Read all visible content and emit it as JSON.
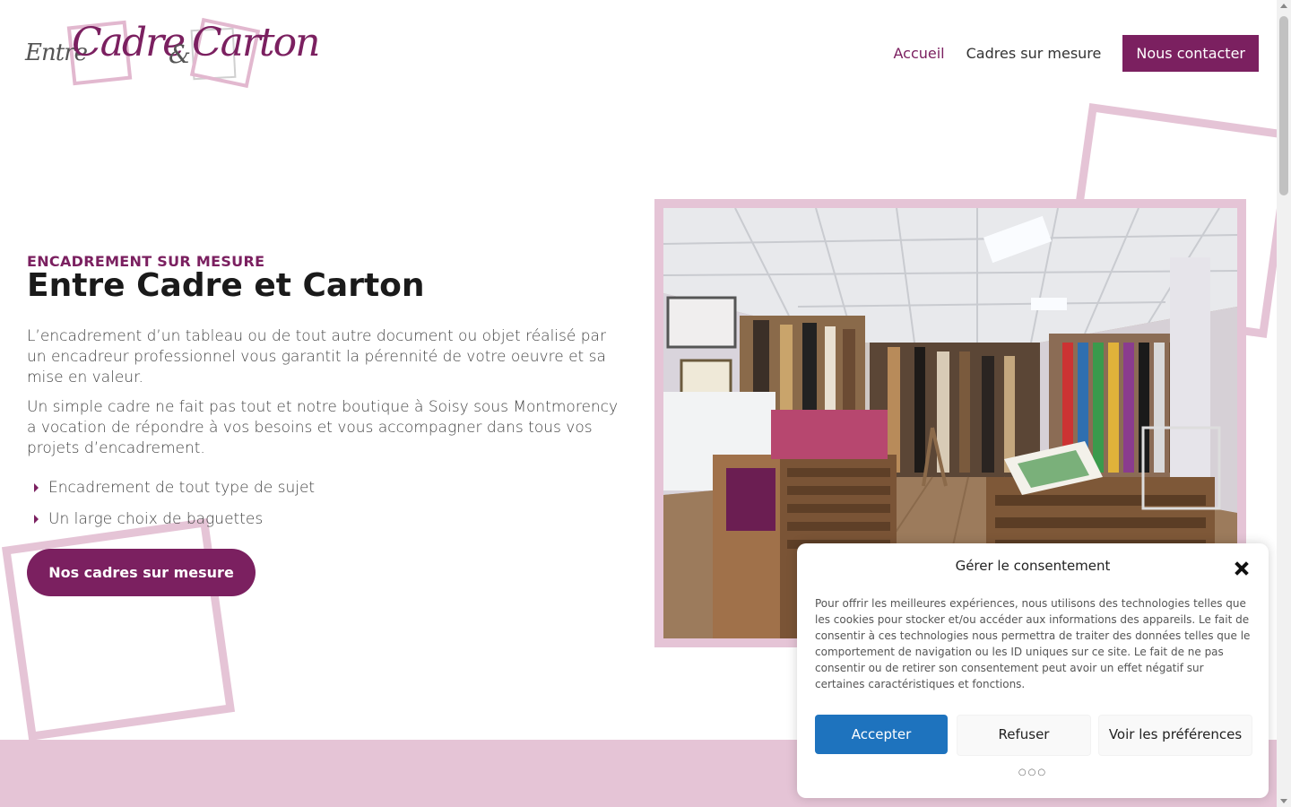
{
  "header": {
    "logo": {
      "word1": "Entre",
      "word2": "Cadre",
      "word3": "&",
      "word4": "Carton"
    },
    "nav": [
      {
        "label": "Accueil"
      },
      {
        "label": "Cadres sur mesure"
      },
      {
        "label": "Nous contacter"
      }
    ]
  },
  "hero": {
    "kicker": "ENCADREMENT SUR MESURE",
    "title": "Entre Cadre et Carton",
    "paragraph1": "L’encadrement d’un tableau ou de tout autre document ou objet réalisé par un encadreur professionnel vous garantit la pérennité de votre oeuvre et sa mise en valeur.",
    "paragraph2": "Un simple cadre ne fait pas tout et notre boutique à Soisy sous Montmorency a vocation de répondre à vos besoins et vous accompagner dans tous vos projets d’encadrement.",
    "bullets": [
      "Encadrement de tout type de sujet",
      "Un large choix de baguettes"
    ],
    "button": "Nos cadres sur mesure"
  },
  "consent": {
    "title": "Gérer le consentement",
    "text": "Pour offrir les meilleures expériences, nous utilisons des technologies telles que les cookies pour stocker et/ou accéder aux informations des appareils. Le fait de consentir à ces technologies nous permettra de traiter des données telles que le comportement de navigation ou les ID uniques sur ce site. Le fait de ne pas consentir ou de retirer son consentement peut avoir un effet négatif sur certaines caractéristiques et fonctions.",
    "accept": "Accepter",
    "refuse": "Refuser",
    "preferences": "Voir les préférences",
    "more": "○○○"
  },
  "colors": {
    "brand": "#7b2060",
    "pink": "#e5c4d6",
    "accept": "#1e73be"
  },
  "icons": {
    "bullet": "caret-right-icon",
    "close": "close-icon"
  }
}
